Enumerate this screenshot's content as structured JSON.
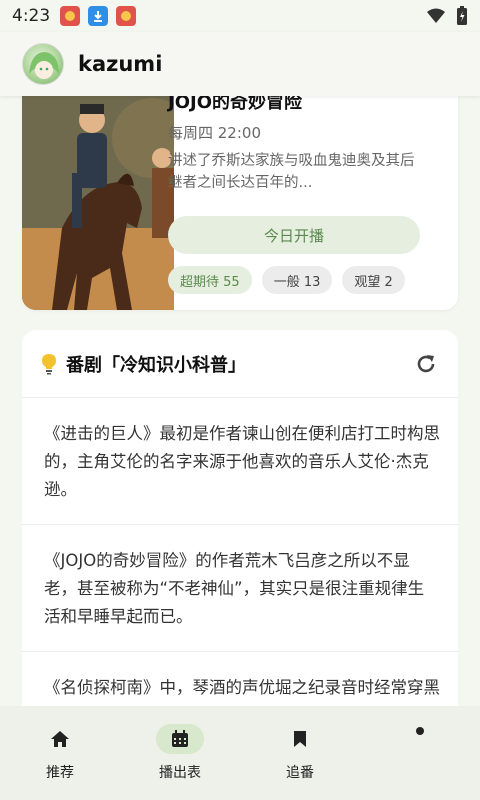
{
  "status_bar": {
    "time": "4:23",
    "notifications": [
      "app-notification-icon",
      "download-icon",
      "app-notification-icon"
    ]
  },
  "header": {
    "username": "kazumi"
  },
  "anime_card": {
    "title": "JOJO的奇妙冒险",
    "air_time": "每周四 22:00",
    "synopsis": "讲述了乔斯达家族与吸血鬼迪奥及其后继者之间长达百年的...",
    "today_button": "今日开播",
    "chips": [
      {
        "label": "超期待 55",
        "style": "super"
      },
      {
        "label": "一般 13",
        "style": "normal"
      },
      {
        "label": "观望 2",
        "style": "normal"
      }
    ]
  },
  "trivia": {
    "title": "番剧「冷知识小科普」",
    "items": [
      "《进击的巨人》最初是作者谏山创在便利店打工时构思的，主角艾伦的名字来源于他喜欢的音乐人艾伦·杰克逊。",
      "《JOJO的奇妙冒险》的作者荒木飞吕彦之所以不显老，甚至被称为“不老神仙”，其实只是很注重规律生活和早睡早起而已。",
      "《名侦探柯南》中，琴酒的声优堀之纪录音时经常穿黑衣服，并且开玩笑说自己就是黑衣组织的"
    ]
  },
  "bottom_nav": {
    "items": [
      {
        "label": "推荐",
        "icon": "home-icon",
        "active": false
      },
      {
        "label": "播出表",
        "icon": "calendar-icon",
        "active": true
      },
      {
        "label": "追番",
        "icon": "bookmark-icon",
        "active": false
      },
      {
        "label": "",
        "icon": "dot-icon",
        "active": false
      }
    ]
  },
  "colors": {
    "accent": "#5a8a4e",
    "accent_bg": "#e6eee0",
    "background": "#f4f6f0"
  }
}
